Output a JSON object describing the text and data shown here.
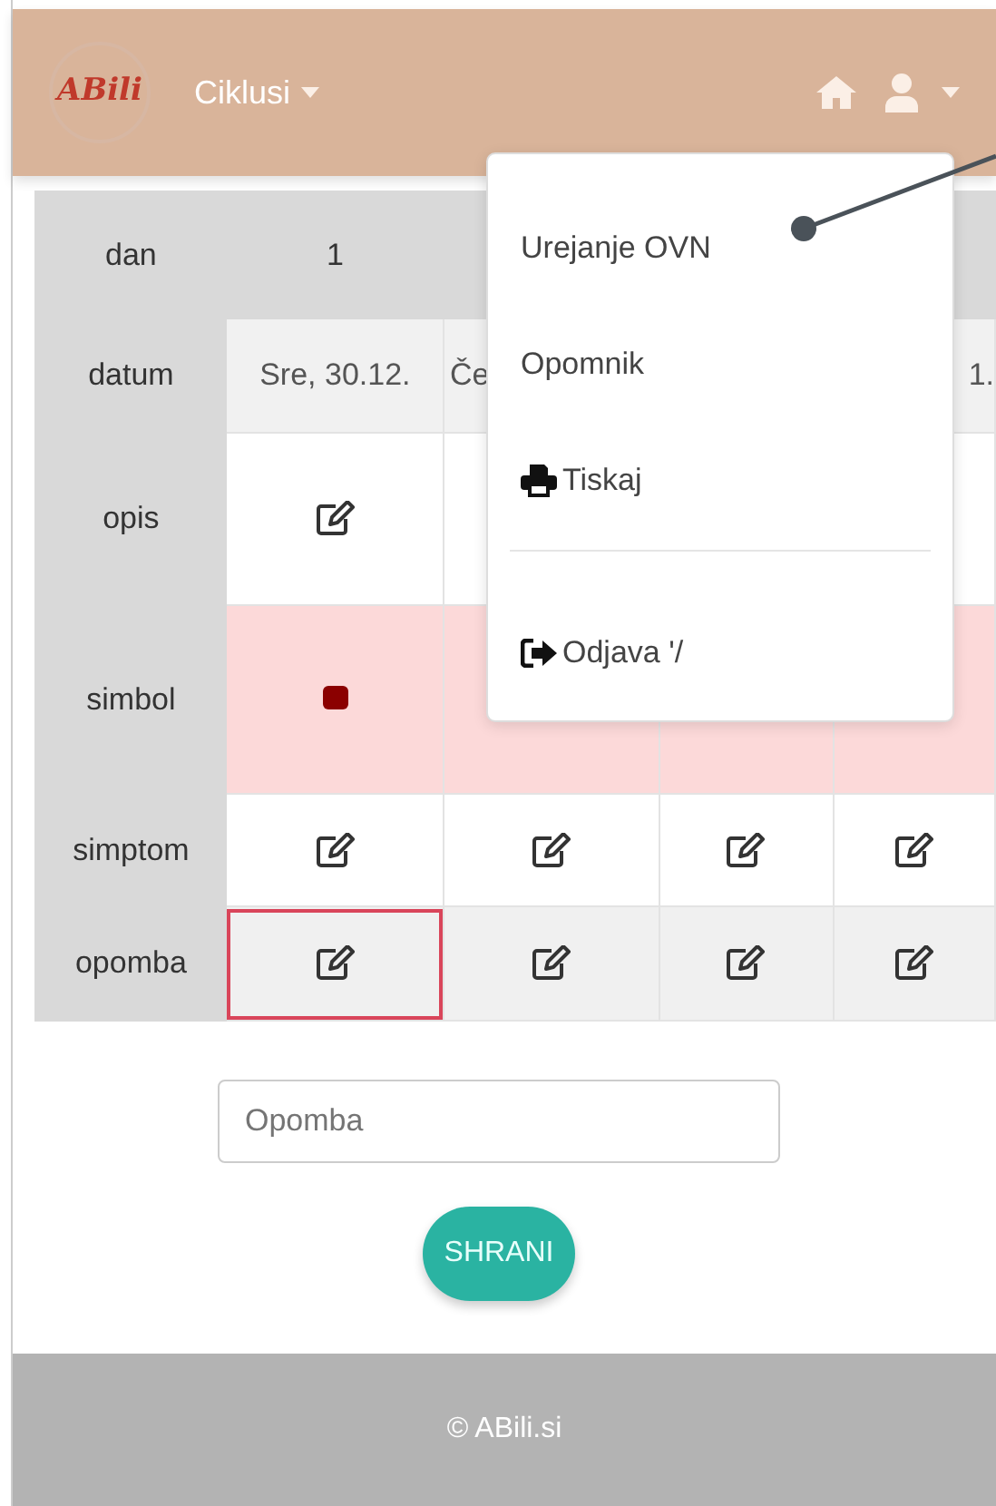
{
  "navbar": {
    "logo": "ABili",
    "menu": {
      "label": "Ciklusi"
    }
  },
  "table": {
    "rows": [
      {
        "kind": "header",
        "label": "dan",
        "cells": [
          {
            "kind": "text",
            "text": "1"
          },
          {
            "kind": "empty"
          },
          {
            "kind": "empty"
          },
          {
            "kind": "empty"
          }
        ]
      },
      {
        "kind": "dates",
        "label": "datum",
        "cells": [
          {
            "kind": "text",
            "text": "Sre, 30.12."
          },
          {
            "kind": "lead",
            "text": "Če"
          },
          {
            "kind": "empty"
          },
          {
            "kind": "tail",
            "text": "1."
          }
        ]
      },
      {
        "kind": "plain",
        "label": "opis",
        "cells": [
          {
            "kind": "edit",
            "selected": false
          },
          {
            "kind": "empty"
          },
          {
            "kind": "empty"
          },
          {
            "kind": "empty"
          }
        ]
      },
      {
        "kind": "pink",
        "label": "simbol",
        "cells": [
          {
            "kind": "symbol",
            "color": "#8b0000"
          },
          {
            "kind": "empty"
          },
          {
            "kind": "empty"
          },
          {
            "kind": "empty"
          }
        ]
      },
      {
        "kind": "plain",
        "label": "simptom",
        "cells": [
          {
            "kind": "edit",
            "selected": false
          },
          {
            "kind": "edit",
            "selected": false
          },
          {
            "kind": "edit",
            "selected": false
          },
          {
            "kind": "edit",
            "selected": false
          }
        ]
      },
      {
        "kind": "striped",
        "label": "opomba",
        "cells": [
          {
            "kind": "edit",
            "selected": true
          },
          {
            "kind": "edit",
            "selected": false
          },
          {
            "kind": "edit",
            "selected": false
          },
          {
            "kind": "edit",
            "selected": false
          }
        ]
      }
    ]
  },
  "dropdown": {
    "items": [
      {
        "kind": "plain",
        "label": "Urejanje OVN"
      },
      {
        "kind": "plain",
        "label": "Opomnik"
      },
      {
        "kind": "print",
        "label": "Tiskaj"
      },
      {
        "kind": "divider"
      },
      {
        "kind": "logout",
        "label": "Odjava '/"
      }
    ]
  },
  "note_field": {
    "placeholder": "Opomba"
  },
  "save_button": "SHRANI",
  "footer": "© ABili.si"
}
